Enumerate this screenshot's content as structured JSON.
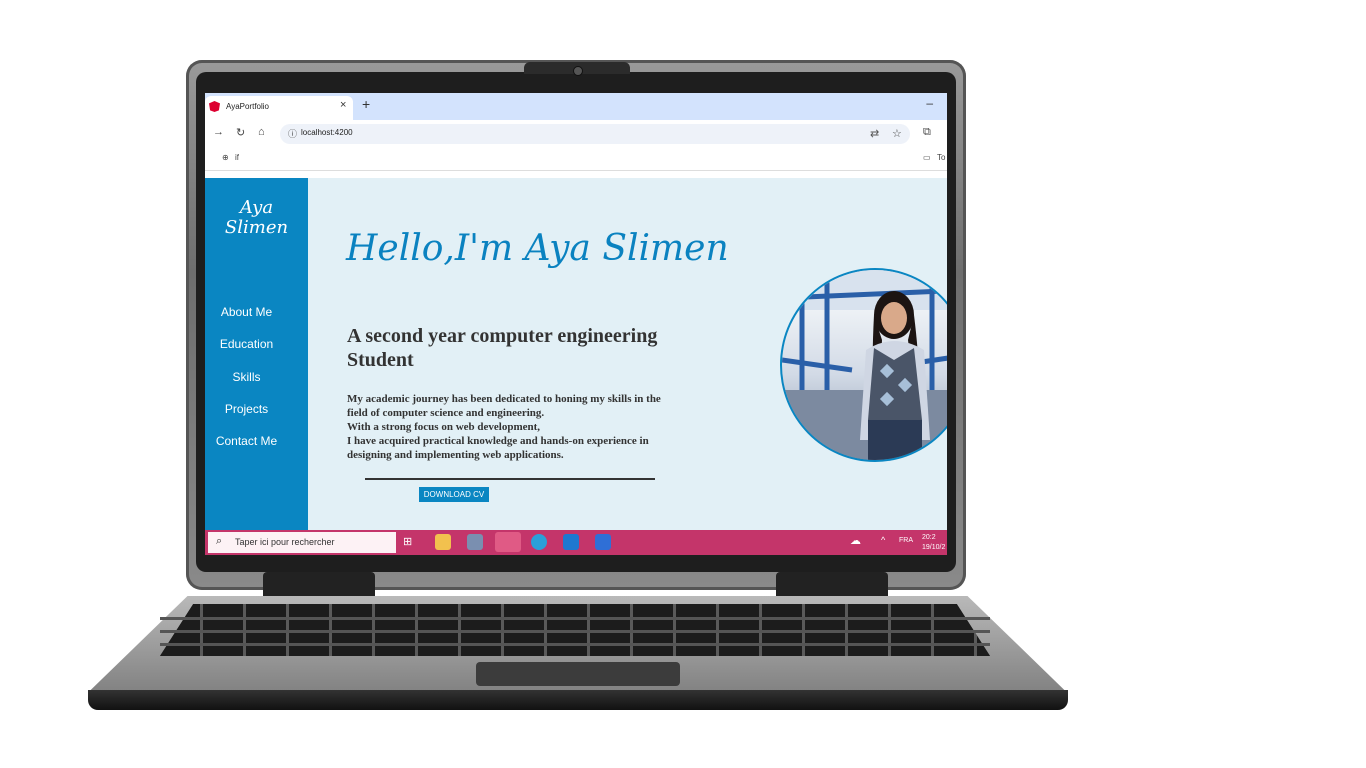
{
  "browser": {
    "tab_title": "AyaPortfolio",
    "tab_close": "×",
    "new_tab": "+",
    "minimize": "–",
    "url": "localhost:4200",
    "bookmark_left": "if",
    "bookmark_right": "To"
  },
  "site": {
    "brand_line1": "Aya",
    "brand_line2": "Slimen",
    "nav": [
      "About Me",
      "Education",
      "Skills",
      "Projects",
      "Contact Me"
    ],
    "hero_title": "Hello,I'm Aya Slimen",
    "subtitle": "A second year computer engineering Student",
    "bio": [
      "My academic journey has been dedicated to honing my skills in the",
      "field of computer science and engineering.",
      "With a strong focus on web development,",
      "I have acquired practical knowledge and hands-on experience in",
      "designing and implementing web applications."
    ],
    "cv_button": "DOWNLOAD CV"
  },
  "taskbar": {
    "search_placeholder": "Taper ici pour rechercher",
    "language": "FRA",
    "time": "20:2",
    "date": "19/10/2"
  },
  "colors": {
    "accent": "#0a86c2",
    "page_bg": "#e2f0f6",
    "taskbar": "#c4356a"
  }
}
